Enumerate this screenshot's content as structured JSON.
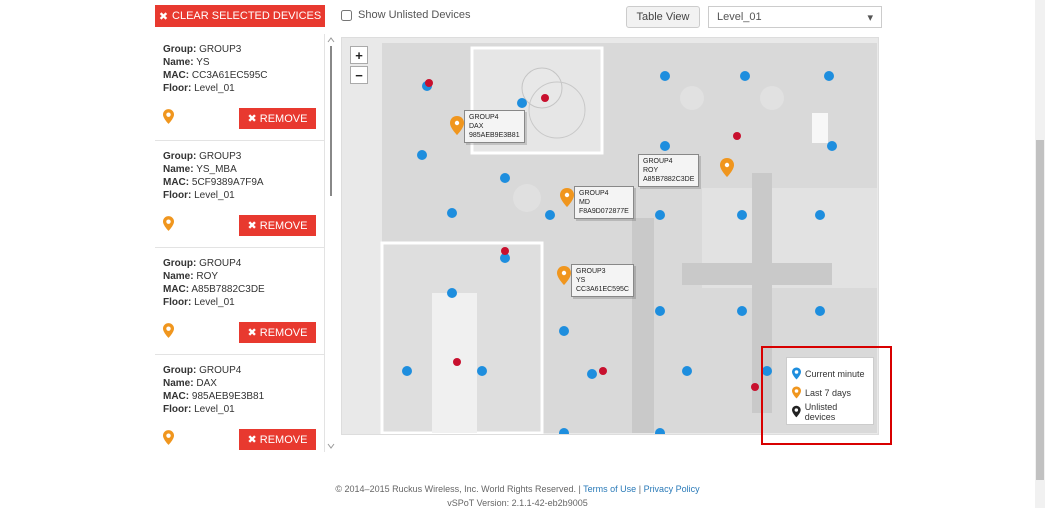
{
  "toolbar": {
    "clear_label": "CLEAR SELECTED DEVICES",
    "show_unlisted_label": "Show Unlisted Devices",
    "table_view_label": "Table View",
    "floor_value": "Level_01"
  },
  "devices": [
    {
      "group": "GROUP3",
      "name": "YS",
      "mac": "CC3A61EC595C",
      "floor": "Level_01",
      "remove_label": "REMOVE"
    },
    {
      "group": "GROUP3",
      "name": "YS_MBA",
      "mac": "5CF9389A7F9A",
      "floor": "Level_01",
      "remove_label": "REMOVE"
    },
    {
      "group": "GROUP4",
      "name": "ROY",
      "mac": "A85B7882C3DE",
      "floor": "Level_01",
      "remove_label": "REMOVE"
    },
    {
      "group": "GROUP4",
      "name": "DAX",
      "mac": "985AEB9E3B81",
      "floor": "Level_01",
      "remove_label": "REMOVE"
    }
  ],
  "labels": {
    "group": "Group:",
    "name": "Name:",
    "mac": "MAC:",
    "floor": "Floor:"
  },
  "map": {
    "zoom_in": "+",
    "zoom_out": "−",
    "tags": [
      {
        "group": "GROUP4",
        "name": "DAX",
        "mac": "985AEB9E3B81"
      },
      {
        "group": "GROUP4",
        "name": "ROY",
        "mac": "A85B7882C3DE"
      },
      {
        "group": "GROUP4",
        "name": "MD",
        "mac": "F8A9D072877E"
      },
      {
        "group": "GROUP3",
        "name": "YS",
        "mac": "CC3A61EC595C"
      }
    ]
  },
  "legend": {
    "current_minute": "Current minute",
    "last_7_days": "Last 7 days",
    "unlisted_devices": "Unlisted devices"
  },
  "colors": {
    "accent_red": "#e8392f",
    "pin_orange": "#f0961e",
    "ap_blue": "#1e8ede",
    "rogue_red": "#c8102e",
    "highlight_frame": "#d80000"
  },
  "footer": {
    "copyright": "© 2014–2015 Ruckus Wireless, Inc. World Rights Reserved. |",
    "terms": "Terms of Use",
    "separator": "|",
    "privacy": "Privacy Policy",
    "version": "vSPoT Version: 2.1.1-42-eb2b9005"
  }
}
